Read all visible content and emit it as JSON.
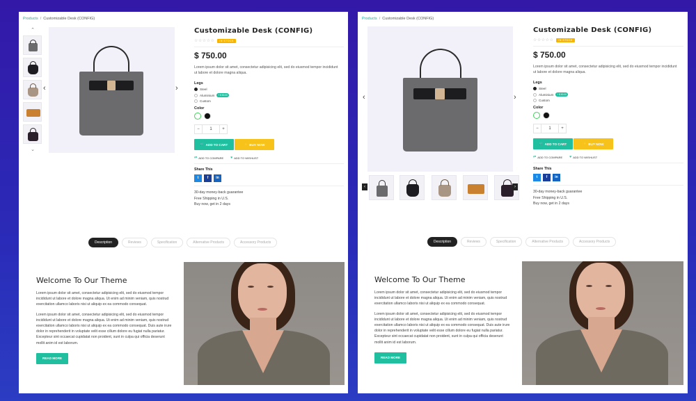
{
  "breadcrumb": {
    "root": "Products",
    "separator": "/",
    "current": "Customizable Desk (CONFIG)"
  },
  "product": {
    "title": "Customizable Desk (CONFIG)",
    "stars": "☆☆☆☆☆",
    "stock_badge": "IN STOCK",
    "price": "$ 750.00",
    "description": "Lorem ipsum dolor sit amet, consectetur adipisicing elit, sed do eiusmod tempor incididunt ut labore et dolore magna aliqua.",
    "legs_label": "Legs",
    "legs_options": [
      "Steel",
      "Aluminium",
      "Custom"
    ],
    "legs_badge": "+ $ 50.00",
    "color_label": "Color",
    "quantity": "1",
    "qty_minus": "−",
    "qty_plus": "+",
    "add_to_cart": "ADD TO CART",
    "buy_now": "BUY NOW",
    "add_to_compare": "ADD TO COMPARE",
    "add_to_wishlist": "ADD TO WISHLIST",
    "share_title": "Share This",
    "share_icons": [
      "t",
      "f",
      "in"
    ],
    "guarantees": [
      "30-day money-back guarantee",
      "Free Shipping in U.S.",
      "Buy now, get in 2 days"
    ]
  },
  "tabs": [
    "Description",
    "Reviews",
    "Specification",
    "Alternative Products",
    "Accessory Products"
  ],
  "welcome": {
    "title": "Welcome To Our Theme",
    "p1": "Lorem ipsum dolor sit amet, consectetur adipisicing elit, sed do eiusmod tempor incididunt ut labore et dolore magna aliqua. Ut enim ad minim veniam, quis nostrud exercitation ullamco laboris nisi ut aliquip ex ea commodo consequat.",
    "p2": "Lorem ipsum dolor sit amet, consectetur adipisicing elit, sed do eiusmod tempor incididunt ut labore et dolore magna aliqua. Ut enim ad minim veniam, quis nostrud exercitation ullamco laboris nisi ut aliquip ex ea commodo consequat. Duis aute irure dolor in reprehenderit in voluptate velit esse cillum dolore eu fugiat nulla pariatur. Excepteur sint occaecat cupidatat non proident, sunt in culpa qui officia deserunt mollit anim id est laborum.",
    "read_more": "READ MORE"
  },
  "colors": {
    "accent": "#1fbf9f",
    "buy": "#f7c21a",
    "background": "#2f20b0"
  }
}
